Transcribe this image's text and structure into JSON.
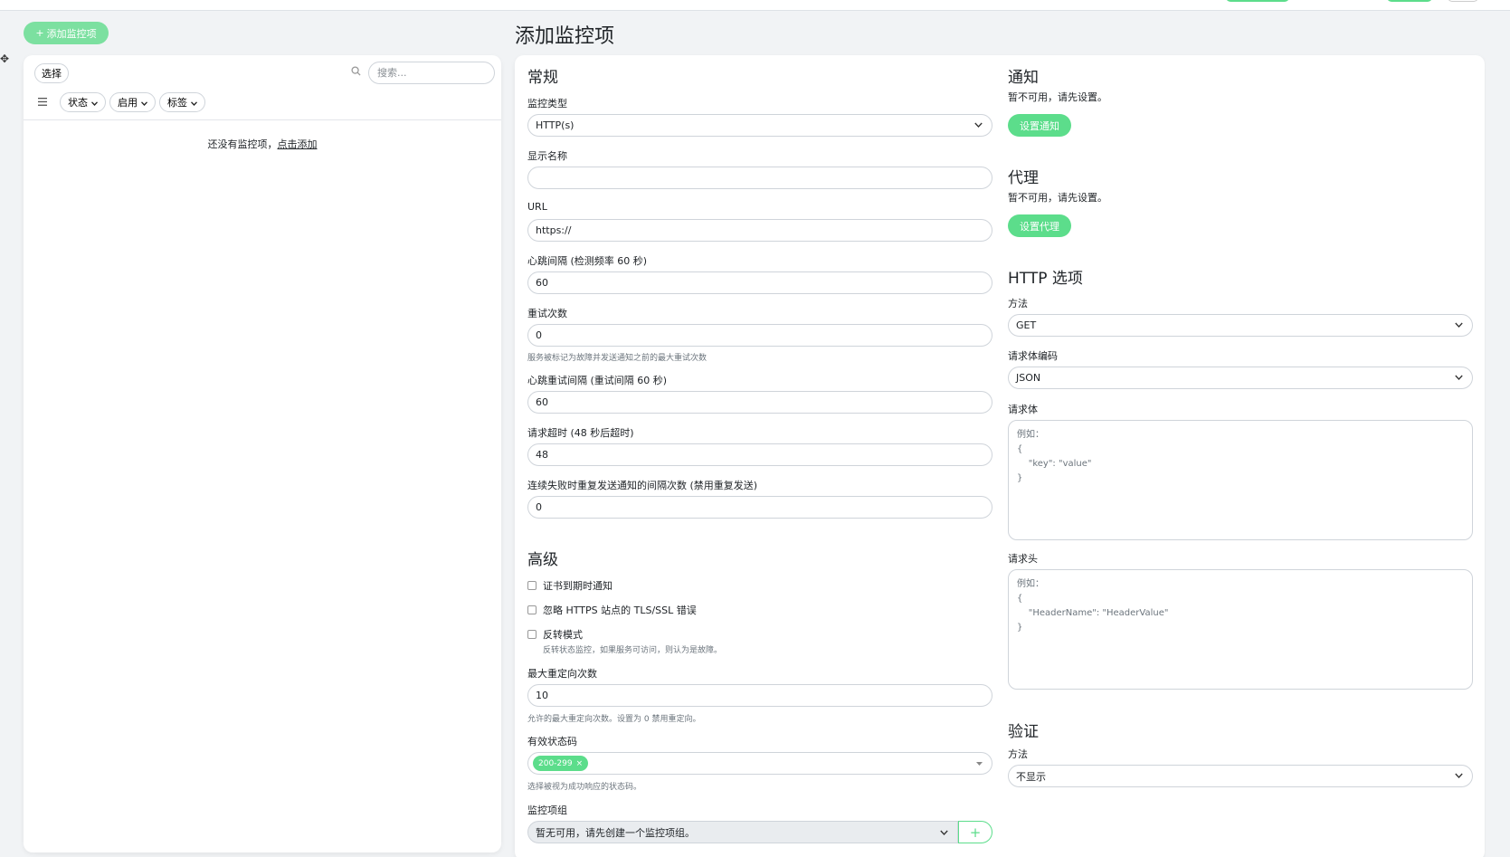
{
  "header": {
    "add_button_label": "添加监控项",
    "add_icon": "+",
    "page_title": "添加监控项"
  },
  "list_panel": {
    "select_label": "选择",
    "search_placeholder": "搜索...",
    "filters": [
      "状态",
      "启用",
      "标签"
    ],
    "empty_text": "还没有监控项，",
    "empty_link": "点击添加"
  },
  "general": {
    "title": "常规",
    "monitor_type_label": "监控类型",
    "monitor_type_value": "HTTP(s)",
    "display_name_label": "显示名称",
    "display_name_value": "",
    "url_label": "URL",
    "url_value": "https://",
    "heartbeat_label": "心跳间隔 (检测频率 60 秒)",
    "heartbeat_value": "60",
    "retries_label": "重试次数",
    "retries_value": "0",
    "retries_hint": "服务被标记为故障并发送通知之前的最大重试次数",
    "retry_interval_label": "心跳重试间隔 (重试间隔 60 秒)",
    "retry_interval_value": "60",
    "timeout_label": "请求超时 (48 秒后超时)",
    "timeout_value": "48",
    "resend_label": "连续失败时重复发送通知的间隔次数 (禁用重复发送)",
    "resend_value": "0"
  },
  "advanced": {
    "title": "高级",
    "cert_expiry_label": "证书到期时通知",
    "ignore_tls_label": "忽略 HTTPS 站点的 TLS/SSL 错误",
    "upside_down_label": "反转模式",
    "upside_down_hint": "反转状态监控，如果服务可访问，则认为是故障。",
    "max_redirects_label": "最大重定向次数",
    "max_redirects_value": "10",
    "max_redirects_hint": "允许的最大重定向次数。设置为 0 禁用重定向。",
    "status_codes_label": "有效状态码",
    "status_code_tag": "200-299",
    "status_code_tag_remove": "×",
    "status_codes_hint": "选择被视为成功响应的状态码。",
    "monitor_group_label": "监控项组",
    "monitor_group_value": "暂无可用，请先创建一个监控项组。",
    "monitor_group_add": "+"
  },
  "notifications": {
    "title": "通知",
    "unavailable": "暂不可用，请先设置。",
    "button": "设置通知"
  },
  "proxy": {
    "title": "代理",
    "unavailable": "暂不可用，请先设置。",
    "button": "设置代理"
  },
  "http_options": {
    "title": "HTTP 选项",
    "method_label": "方法",
    "method_value": "GET",
    "body_encoding_label": "请求体编码",
    "body_encoding_value": "JSON",
    "body_label": "请求体",
    "body_placeholder": "例如：\n{\n    \"key\": \"value\"\n}",
    "headers_label": "请求头",
    "headers_placeholder": "例如：\n{\n    \"HeaderName\": \"HeaderValue\"\n}"
  },
  "auth": {
    "title": "验证",
    "method_label": "方法",
    "method_value": "不显示"
  },
  "icons": {
    "search": "search-icon",
    "menu": "list-icon",
    "chevron": "chevron-down-icon"
  },
  "colors": {
    "accent": "#5cdd8b",
    "background": "#f1f3f5"
  }
}
